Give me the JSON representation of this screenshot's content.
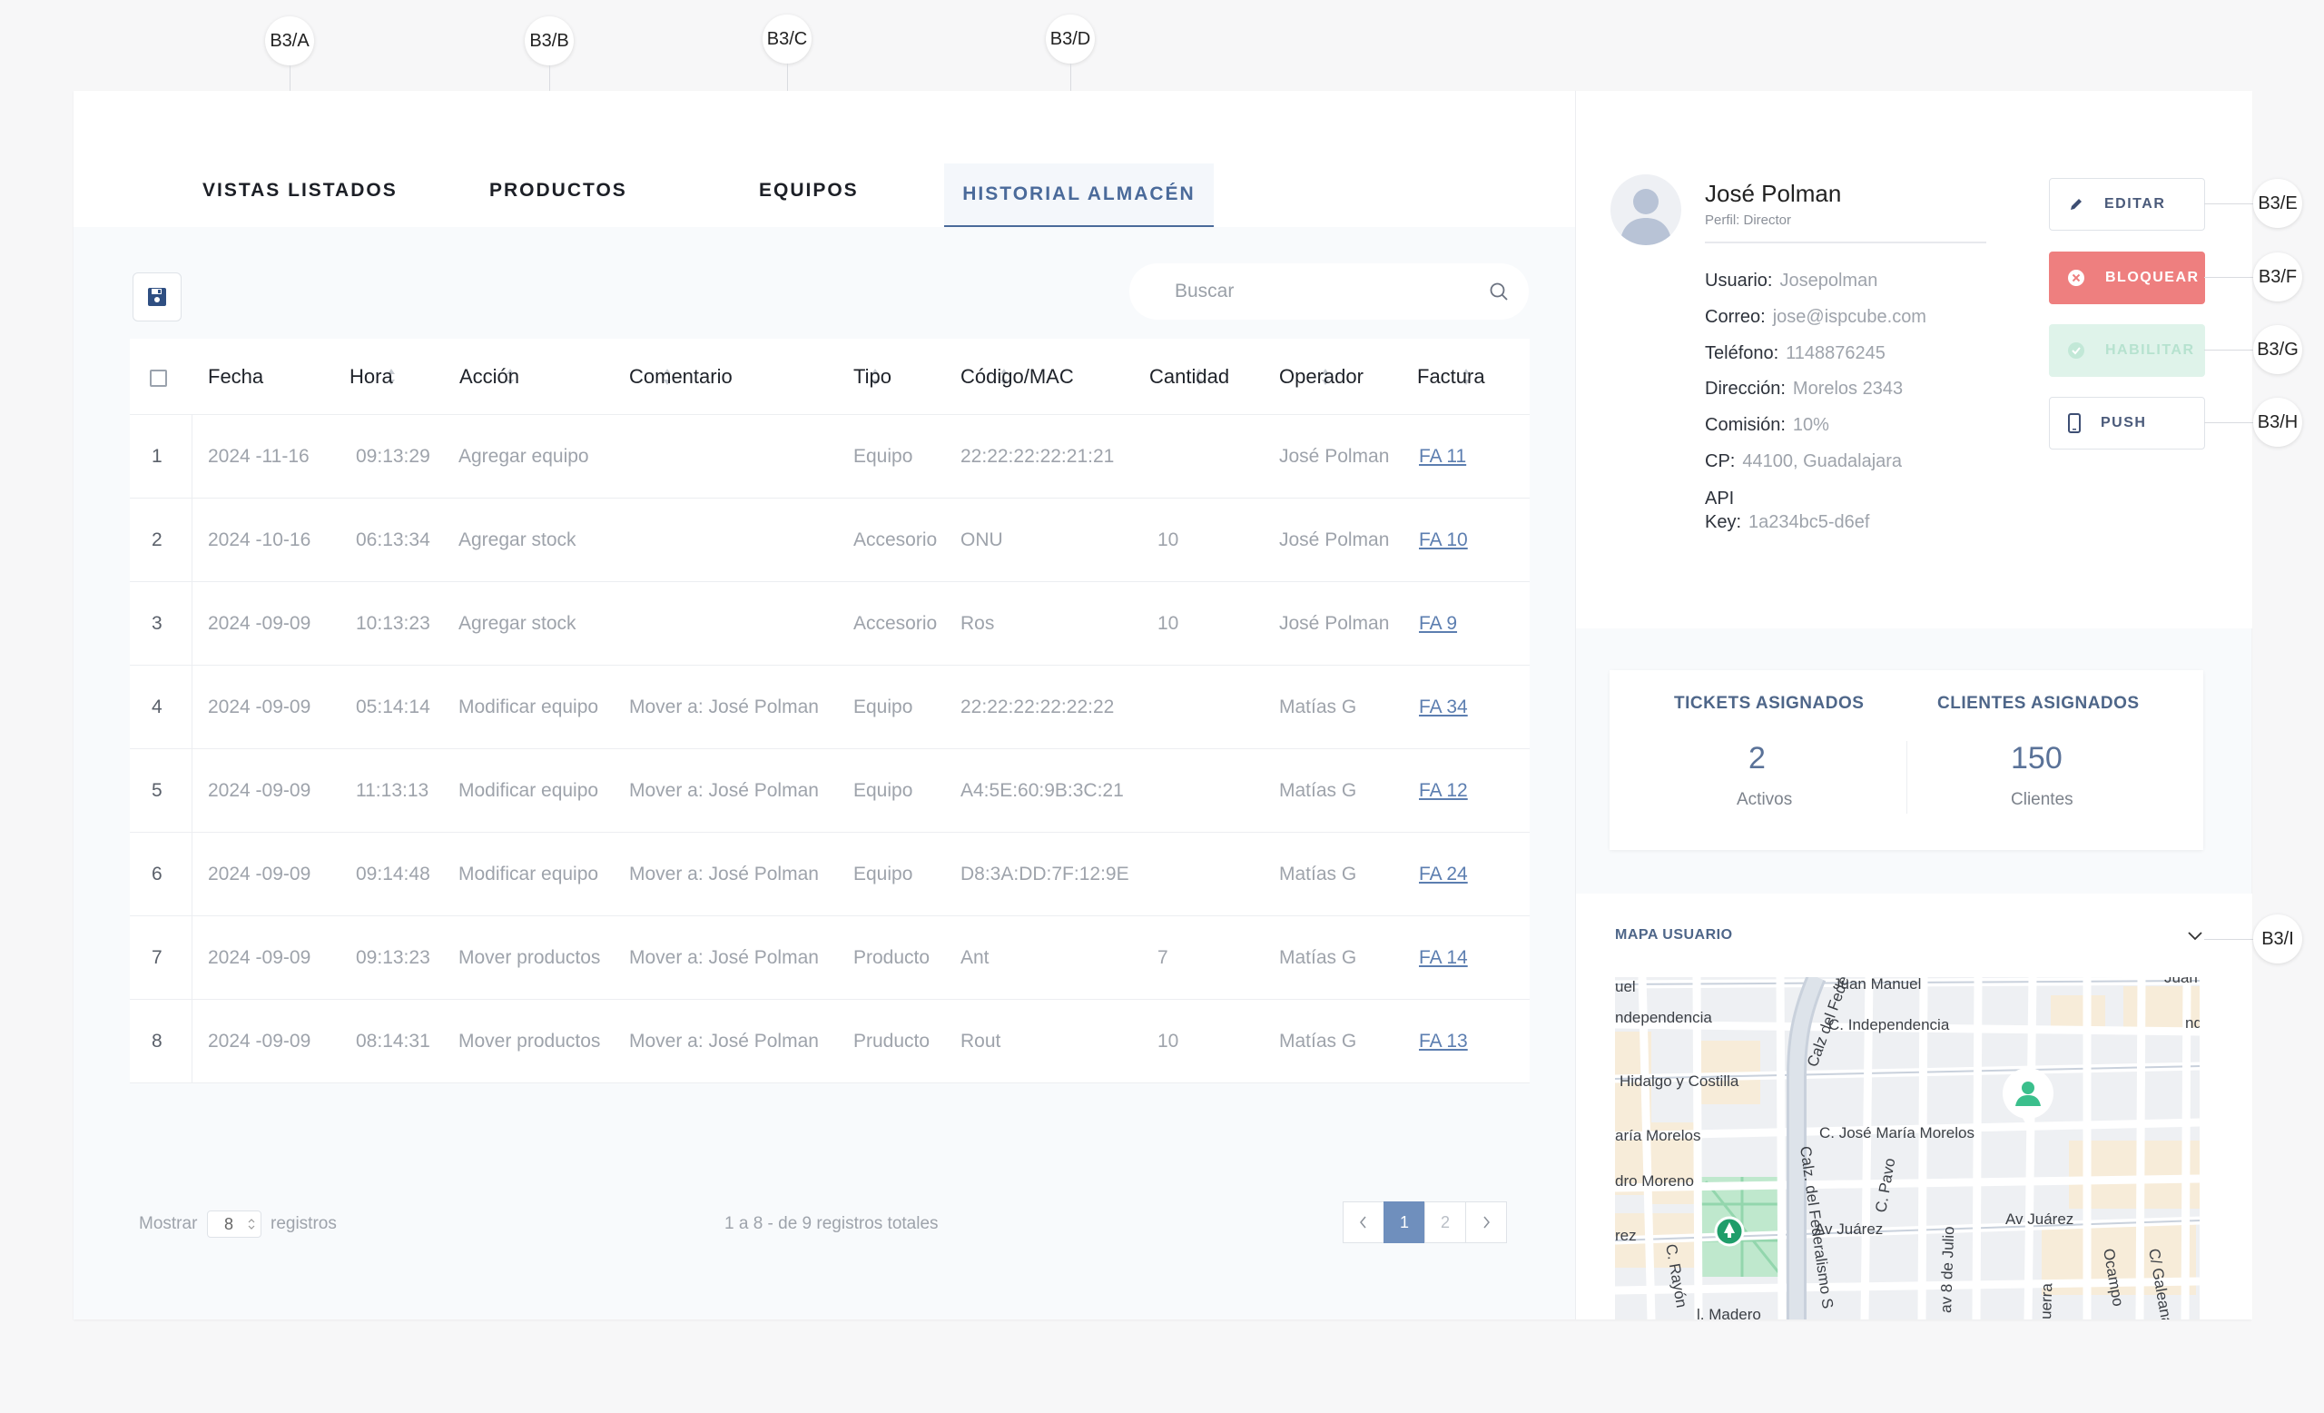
{
  "callouts": {
    "a": "B3/A",
    "b": "B3/B",
    "c": "B3/C",
    "d": "B3/D",
    "e": "B3/E",
    "f": "B3/F",
    "g": "B3/G",
    "h": "B3/H",
    "i": "B3/I"
  },
  "tabs": [
    {
      "label": "VISTAS LISTADOS"
    },
    {
      "label": "PRODUCTOS"
    },
    {
      "label": "EQUIPOS"
    },
    {
      "label": "HISTORIAL ALMACÉN",
      "active": true
    }
  ],
  "toolbar": {
    "save_icon": "floppy-disk-icon",
    "search_placeholder": "Buscar",
    "search_icon": "search-icon"
  },
  "table": {
    "columns": [
      "Fecha",
      "Hora",
      "Acción",
      "Comentario",
      "Tipo",
      "Código/MAC",
      "Cantidad",
      "Operador",
      "Factura"
    ],
    "rows": [
      {
        "n": "1",
        "fecha": "2024 -11-16",
        "hora": "09:13:29",
        "accion": "Agregar equipo",
        "comentario": "",
        "tipo": "Equipo",
        "codigo": "22:22:22:22:21:21",
        "cantidad": "",
        "operador": "José Polman",
        "factura": "FA 11"
      },
      {
        "n": "2",
        "fecha": "2024 -10-16",
        "hora": "06:13:34",
        "accion": "Agregar stock",
        "comentario": "",
        "tipo": "Accesorio",
        "codigo": "ONU",
        "cantidad": "10",
        "operador": "José Polman",
        "factura": "FA 10"
      },
      {
        "n": "3",
        "fecha": "2024 -09-09",
        "hora": "10:13:23",
        "accion": "Agregar stock",
        "comentario": "",
        "tipo": "Accesorio",
        "codigo": "Ros",
        "cantidad": "10",
        "operador": "José Polman",
        "factura": "FA 9"
      },
      {
        "n": "4",
        "fecha": "2024 -09-09",
        "hora": "05:14:14",
        "accion": "Modificar equipo",
        "comentario": "Mover a: José Polman",
        "tipo": "Equipo",
        "codigo": "22:22:22:22:22:22",
        "cantidad": "",
        "operador": "Matías G",
        "factura": "FA 34"
      },
      {
        "n": "5",
        "fecha": "2024 -09-09",
        "hora": "11:13:13",
        "accion": "Modificar equipo",
        "comentario": "Mover a: José Polman",
        "tipo": "Equipo",
        "codigo": "A4:5E:60:9B:3C:21",
        "cantidad": "",
        "operador": "Matías G",
        "factura": "FA 12"
      },
      {
        "n": "6",
        "fecha": "2024 -09-09",
        "hora": "09:14:48",
        "accion": "Modificar equipo",
        "comentario": "Mover a: José Polman",
        "tipo": "Equipo",
        "codigo": "D8:3A:DD:7F:12:9E",
        "cantidad": "",
        "operador": "Matías G",
        "factura": "FA 24"
      },
      {
        "n": "7",
        "fecha": "2024 -09-09",
        "hora": "09:13:23",
        "accion": "Mover productos",
        "comentario": "Mover a: José Polman",
        "tipo": "Producto",
        "codigo": "Ant",
        "cantidad": "7",
        "operador": "Matías G",
        "factura": "FA 14"
      },
      {
        "n": "8",
        "fecha": "2024 -09-09",
        "hora": "08:14:31",
        "accion": "Mover productos",
        "comentario": "Mover a: José Polman",
        "tipo": "Pruducto",
        "codigo": "Rout",
        "cantidad": "10",
        "operador": "Matías G",
        "factura": "FA 13"
      }
    ]
  },
  "footer": {
    "mostrar": "Mostrar",
    "per_page": "8",
    "registros": "registros",
    "summary": "1 a 8  - de 9 registros totales",
    "pages": [
      "1",
      "2"
    ],
    "current_page": "1"
  },
  "profile": {
    "name": "José Polman",
    "role": "Perfil: Director",
    "fields": [
      {
        "label": "Usuario:",
        "value": "Josepolman"
      },
      {
        "label": "Correo:",
        "value": "jose@ispcube.com"
      },
      {
        "label": "Teléfono:",
        "value": "1148876245"
      },
      {
        "label": "Dirección:",
        "value": "Morelos 2343"
      },
      {
        "label": "Comisión:",
        "value": "10%"
      },
      {
        "label": "CP:",
        "value": "44100, Guadalajara"
      }
    ],
    "api_label_1": "API",
    "api_label_2": "Key:",
    "api_value": "1a234bc5-d6ef"
  },
  "actions": {
    "edit": "EDITAR",
    "block": "BLOQUEAR",
    "enable": "HABILITAR",
    "push": "PUSH"
  },
  "stats": {
    "tickets_title": "TICKETS ASIGNADOS",
    "tickets_value": "2",
    "tickets_sub": "Activos",
    "clients_title": "CLIENTES ASIGNADOS",
    "clients_value": "150",
    "clients_sub": "Clientes"
  },
  "map": {
    "title": "MAPA USUARIO",
    "labels": [
      "uel",
      "Juan Manuel",
      "Juan",
      "ndependencia",
      "C. Independencia",
      "nd",
      "Calz del Fede",
      "Hidalgo y Costilla",
      "C. José María Morelos",
      "aría Morelos",
      "dro Moreno",
      "rez",
      "Av Juárez",
      "Av Juárez",
      "C. Pavo",
      "Calz. del Federalismo S",
      "C. Rayón",
      "av 8 de Julio",
      "Ocampo",
      "C/ Galeana",
      "uerra",
      "l. Madero"
    ]
  },
  "colors": {
    "accent": "#4a6a9a",
    "danger": "#ee7f7f",
    "success_light": "#dff3ea",
    "link": "#5c7eb0"
  }
}
